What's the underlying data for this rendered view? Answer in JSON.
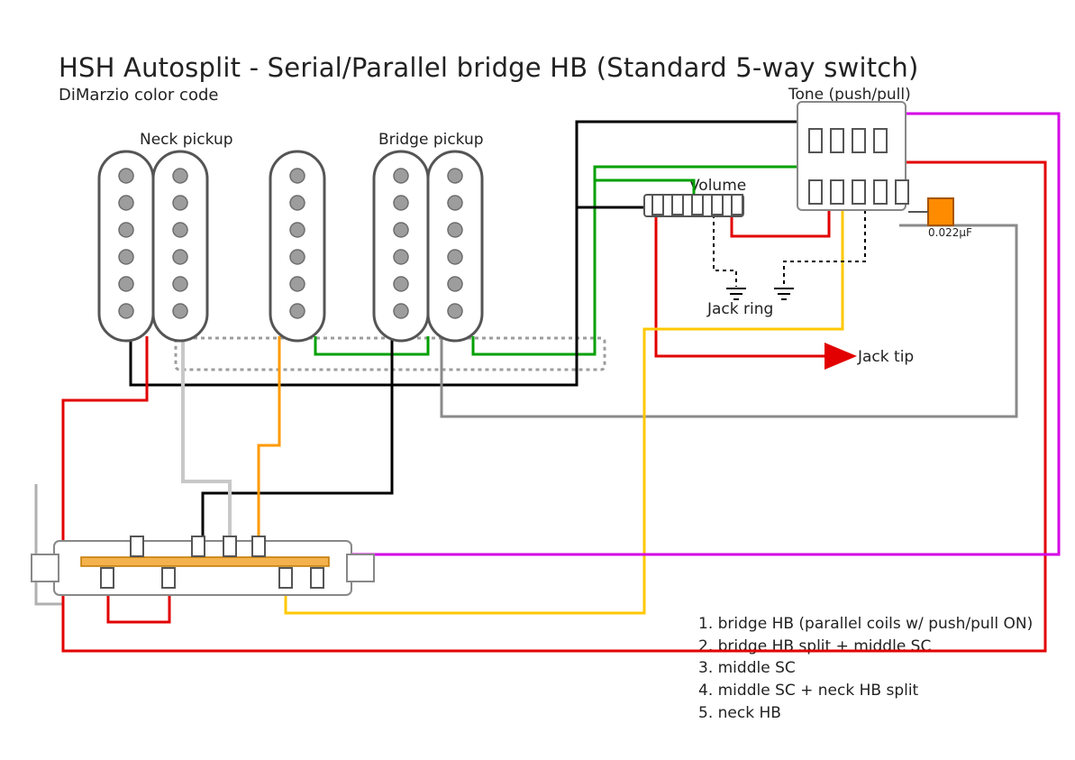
{
  "title": "HSH Autosplit - Serial/Parallel bridge HB (Standard 5-way switch)",
  "subtitle": "DiMarzio color code",
  "labels": {
    "neckPickup": "Neck pickup",
    "bridgePickup": "Bridge pickup",
    "volume": "Volume",
    "tone": "Tone (push/pull)",
    "jackRing": "Jack ring",
    "jackTip": "Jack tip",
    "capValue": "0.022μF"
  },
  "legend": {
    "l1": "1. bridge HB (parallel coils w/ push/pull ON)",
    "l2": "2. bridge HB split + middle SC",
    "l3": "3. middle SC",
    "l4": "4. middle SC + neck HB split",
    "l5": "5. neck HB"
  },
  "colors": {
    "red": "#e20000",
    "green": "#00a000",
    "black": "#000000",
    "grey": "#8a8a8a",
    "lightgrey": "#c8c8c8",
    "orange": "#ff9a00",
    "yellow": "#ffc800",
    "magenta": "#d400e6",
    "fill": "#ffffff",
    "pole": "#9d9d9d",
    "switchbar": "#f3b24d",
    "cap": "#ff8c00"
  },
  "diagram": {
    "pickups": [
      {
        "name": "neck-humbucker",
        "type": "humbucker"
      },
      {
        "name": "middle-singlecoil",
        "type": "singlecoil"
      },
      {
        "name": "bridge-humbucker",
        "type": "humbucker"
      }
    ],
    "pots": [
      {
        "name": "volume",
        "type": "pot"
      },
      {
        "name": "tone-push-pull",
        "type": "push-pull-pot"
      }
    ],
    "switch": {
      "name": "5-way-switch",
      "type": "5-way-lever"
    },
    "capacitor": {
      "value": "0.022uF"
    }
  }
}
